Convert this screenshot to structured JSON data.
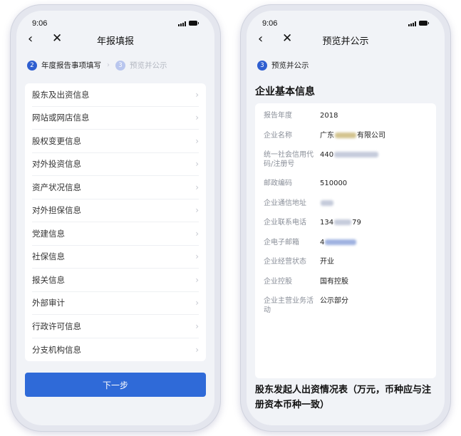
{
  "left_screen": {
    "status": {
      "time": "9:06"
    },
    "nav": {
      "back_icon": "chevron-left-icon",
      "close_icon": "close-icon",
      "title": "年报填报"
    },
    "steps": [
      {
        "number": "2",
        "label": "年度报告事项填写",
        "state": "active"
      },
      {
        "number": "3",
        "label": "预览并公示",
        "state": "inactive"
      }
    ],
    "items": [
      "股东及出资信息",
      "网站或网店信息",
      "股权变更信息",
      "对外投资信息",
      "资产状况信息",
      "对外担保信息",
      "党建信息",
      "社保信息",
      "报关信息",
      "外部审计",
      "行政许可信息",
      "分支机构信息"
    ],
    "next_button": "下一步"
  },
  "right_screen": {
    "status": {
      "time": "9:06"
    },
    "nav": {
      "back_icon": "chevron-left-icon",
      "close_icon": "close-icon",
      "title": "预览并公示"
    },
    "step": {
      "number": "3",
      "label": "预览并公示"
    },
    "section_title": "企业基本信息",
    "fields": {
      "year": {
        "label": "报告年度",
        "value": "2018"
      },
      "name": {
        "label": "企业名称",
        "prefix": "广东",
        "suffix": "有限公司"
      },
      "credit_code": {
        "label": "统一社会信用代码/注册号",
        "prefix": "440"
      },
      "postal": {
        "label": "邮政编码",
        "value": "510000"
      },
      "address": {
        "label": "企业通信地址"
      },
      "phone": {
        "label": "企业联系电话",
        "prefix": "134",
        "suffix": "79"
      },
      "email": {
        "label": "企电子邮箱",
        "prefix": "4"
      },
      "status": {
        "label": "企业经营状态",
        "value": "开业"
      },
      "holding": {
        "label": "企业控股",
        "value": "国有控股"
      },
      "business": {
        "label": "企业主营业务活动",
        "value": "公示部分"
      }
    },
    "bottom_title": "股东发起人出资情况表（万元，币种应与注册资本币种一致）"
  }
}
